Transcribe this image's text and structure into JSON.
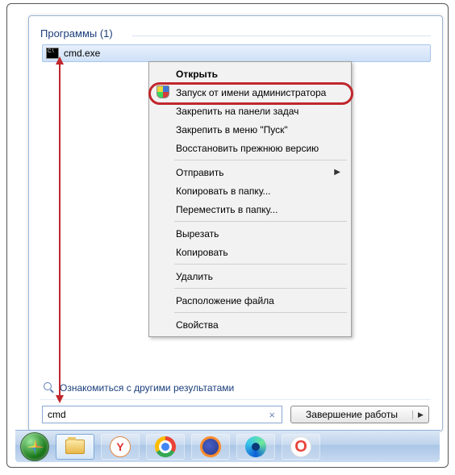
{
  "section": {
    "header": "Программы (1)",
    "result_name": "cmd.exe"
  },
  "context_menu": {
    "open": "Открыть",
    "run_as_admin": "Запуск от имени администратора",
    "pin_taskbar": "Закрепить на панели задач",
    "pin_start": "Закрепить в меню \"Пуск\"",
    "restore_prev": "Восстановить прежнюю версию",
    "send_to": "Отправить",
    "copy_to_folder": "Копировать в папку...",
    "move_to_folder": "Переместить в папку...",
    "cut": "Вырезать",
    "copy": "Копировать",
    "delete": "Удалить",
    "file_location": "Расположение файла",
    "properties": "Свойства"
  },
  "more_results": "Ознакомиться с другими результатами",
  "search": {
    "value": "cmd"
  },
  "shutdown": {
    "label": "Завершение работы"
  },
  "taskbar": {
    "yandex_letter": "Y",
    "opera_letter": "O"
  }
}
